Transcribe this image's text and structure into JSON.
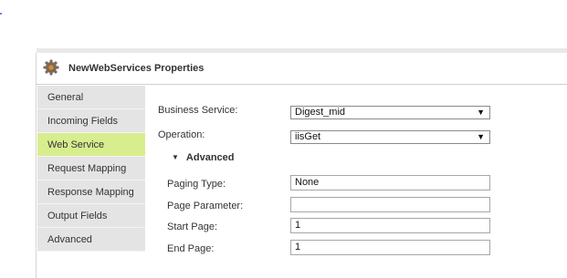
{
  "header": {
    "title": "NewWebServices Properties",
    "icon": "gear-icon"
  },
  "sidebar": {
    "items": [
      {
        "label": "General"
      },
      {
        "label": "Incoming Fields"
      },
      {
        "label": "Web Service"
      },
      {
        "label": "Request Mapping"
      },
      {
        "label": "Response Mapping"
      },
      {
        "label": "Output Fields"
      },
      {
        "label": "Advanced"
      }
    ],
    "active_color": "#d8ed8d"
  },
  "form": {
    "business_service": {
      "label": "Business Service:",
      "value": "Digest_mid"
    },
    "operation": {
      "label": "Operation:",
      "value": "iisGet"
    },
    "advanced": {
      "label": "Advanced",
      "expanded": true
    },
    "paging_type": {
      "label": "Paging Type:",
      "value": "None"
    },
    "page_parameter": {
      "label": "Page Parameter:",
      "value": ""
    },
    "start_page": {
      "label": "Start Page:",
      "value": "1"
    },
    "end_page": {
      "label": "End Page:",
      "value": "1"
    }
  }
}
